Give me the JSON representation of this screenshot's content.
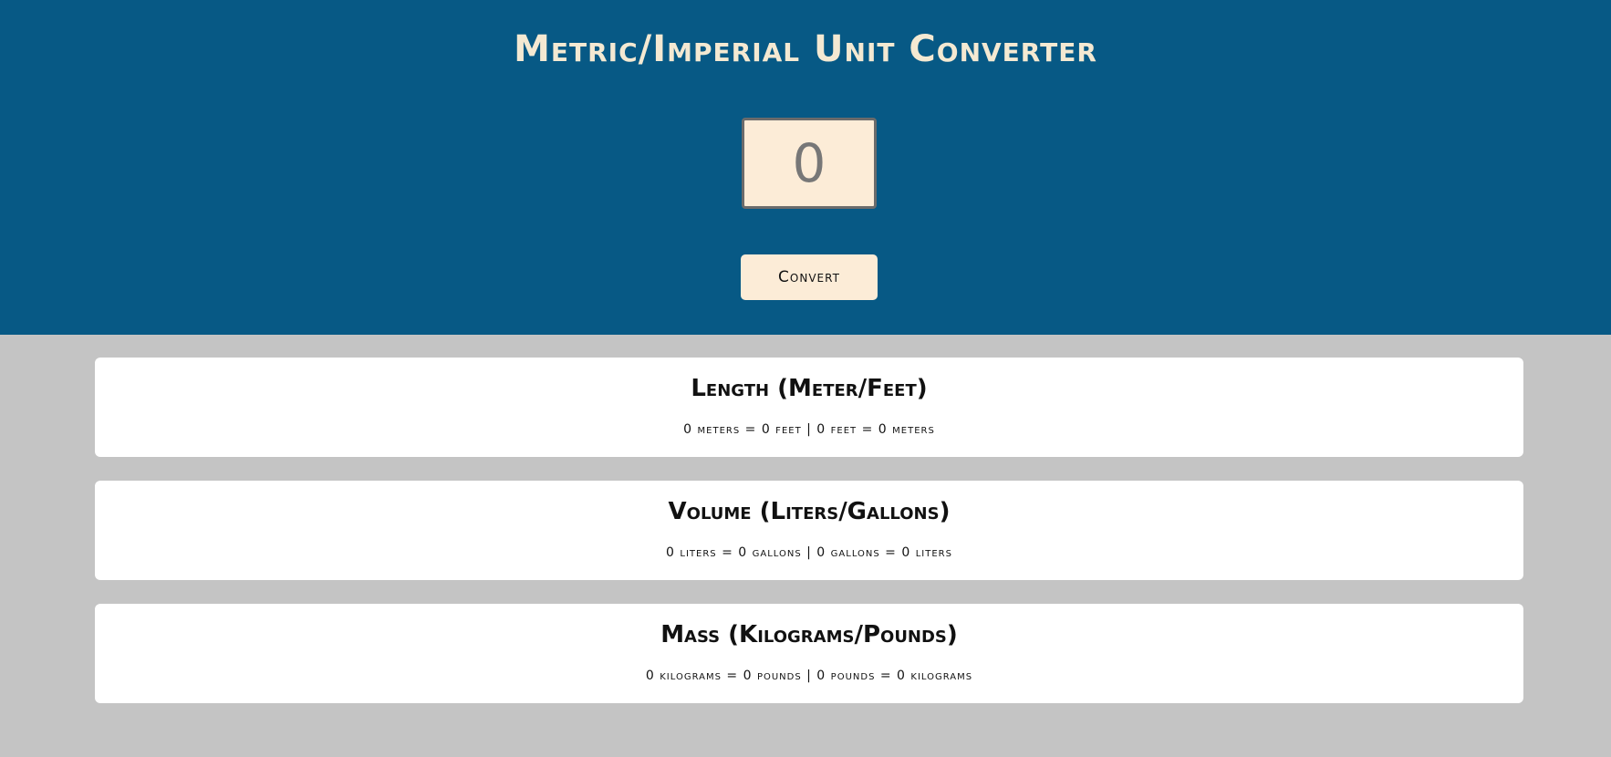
{
  "header": {
    "title": "Metric/Imperial Unit Converter",
    "input_value": "0",
    "convert_label": "Convert"
  },
  "cards": [
    {
      "title": "Length (Meter/Feet)",
      "text": "0 meters = 0 feet | 0 feet = 0 meters"
    },
    {
      "title": "Volume (Liters/Gallons)",
      "text": "0 liters = 0 gallons | 0 gallons = 0 liters"
    },
    {
      "title": "Mass (Kilograms/Pounds)",
      "text": "0 kilograms = 0 pounds | 0 pounds = 0 kilograms"
    }
  ],
  "colors": {
    "header_bg": "#075985",
    "page_bg": "#c4c4c4",
    "accent": "#fcecd7"
  }
}
